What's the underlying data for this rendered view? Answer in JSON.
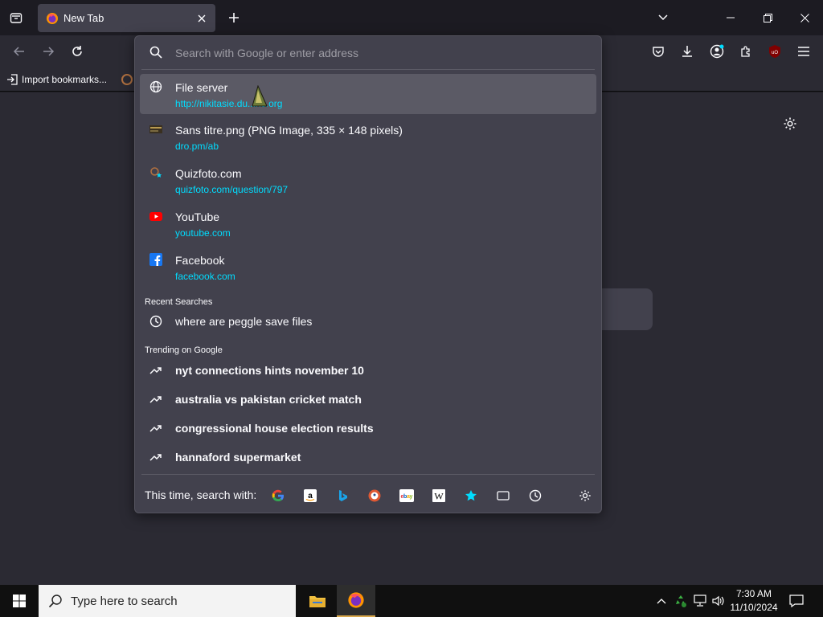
{
  "tabs": [
    {
      "title": "New Tab",
      "favicon": "firefox-icon"
    }
  ],
  "toolbar": {
    "back_icon": "back-arrow-icon",
    "forward_icon": "forward-arrow-icon",
    "reload_icon": "reload-icon"
  },
  "bookmarks": {
    "import_label": "Import bookmarks..."
  },
  "urlbar": {
    "placeholder": "Search with Google or enter address",
    "results": [
      {
        "title": "File server",
        "url": "http://nikitasie.du...ns.org",
        "icon": "globe-icon",
        "selected": true
      },
      {
        "title": "Sans titre.png (PNG Image, 335 × 148 pixels)",
        "url": "dro.pm/ab",
        "icon": "image-thumbnail-icon"
      },
      {
        "title": "Quizfoto.com",
        "url": "quizfoto.com/question/797",
        "icon": "quizfoto-bookmark-icon"
      },
      {
        "title": "YouTube",
        "url": "youtube.com",
        "icon": "youtube-icon"
      },
      {
        "title": "Facebook",
        "url": "facebook.com",
        "icon": "facebook-icon"
      }
    ],
    "recent_label": "Recent Searches",
    "recent": [
      {
        "title": "where are peggle save files",
        "icon": "clock-icon"
      }
    ],
    "trending_label": "Trending on Google",
    "trending": [
      {
        "title": "nyt connections hints november 10"
      },
      {
        "title": "australia vs pakistan cricket match"
      },
      {
        "title": "congressional house election results"
      },
      {
        "title": "hannaford supermarket"
      }
    ],
    "oneoff_label": "This time, search with:",
    "engines": [
      "google-icon",
      "amazon-icon",
      "bing-icon",
      "duckduckgo-icon",
      "ebay-icon",
      "wikipedia-icon",
      "bookmarks-star-icon",
      "tabs-icon",
      "history-icon"
    ]
  },
  "taskbar": {
    "search_placeholder": "Type here to search",
    "time": "7:30 AM",
    "date": "11/10/2024"
  },
  "colors": {
    "accent_url": "#00ddff",
    "panel_bg": "#42414d",
    "selected_bg": "#5b5a65",
    "toolbar_bg": "#2b2a33",
    "tabstrip_bg": "#1c1b22"
  }
}
